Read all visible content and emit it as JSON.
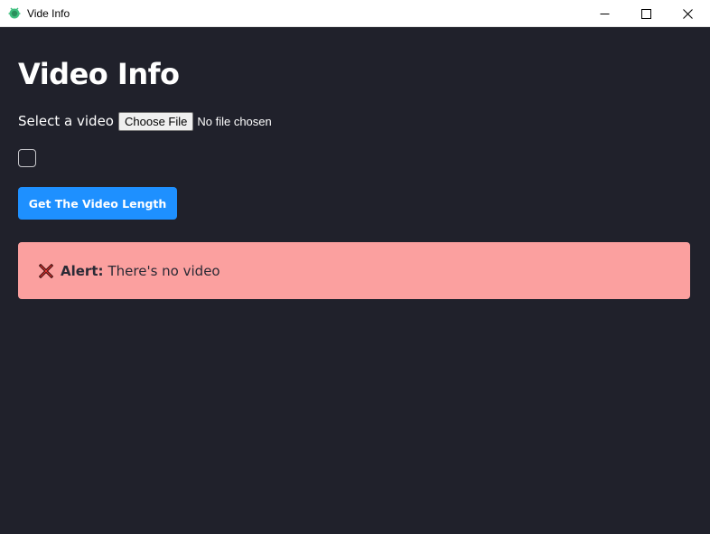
{
  "window": {
    "title": "Vide Info"
  },
  "page": {
    "heading": "Video Info"
  },
  "file_input": {
    "label": "Select a video",
    "button_label": "Choose File",
    "status": "No file chosen"
  },
  "checkbox": {
    "checked": false
  },
  "actions": {
    "primary_label": "Get The Video Length"
  },
  "alert": {
    "label": "Alert:",
    "message": "There's no video",
    "icon": "cross-mark-icon"
  },
  "colors": {
    "background": "#20212b",
    "primary": "#1e90ff",
    "alert_bg": "#fba09f",
    "alert_icon": "#e0302e"
  }
}
